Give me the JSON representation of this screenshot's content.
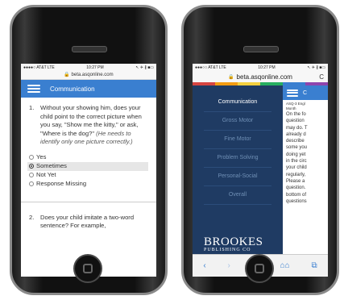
{
  "left_phone": {
    "status": {
      "carrier": "●●●●○ AT&T  LTE",
      "time": "10:27 PM",
      "right": "↖ ✈ ∦ ■▭"
    },
    "url": "🔒 beta.asqonline.com",
    "nav_title": "Communication",
    "question1": {
      "number": "1.",
      "text": "Without your showing him, does your child point to the correct picture when you say, \"Show me the kitty,\" or ask, \"Where is the dog?\"",
      "note": "(He needs to identify only one picture correctly.)"
    },
    "options": [
      "Yes",
      "Sometimes",
      "Not Yet",
      "Response Missing"
    ],
    "selected_option": "Sometimes",
    "question2": {
      "number": "2.",
      "text": "Does your child imitate a two-word sentence? For example,"
    }
  },
  "right_phone": {
    "status": {
      "carrier": "●●●○○ AT&T  LTE",
      "time": "10:27 PM",
      "right": "↖ ✈ ∦ ■▭"
    },
    "url": "beta.asqonline.com",
    "reload": "C",
    "menu_items": [
      "Communication",
      "Gross Motor",
      "Fine Motor",
      "Problem Solving",
      "Personal-Social",
      "Overall"
    ],
    "brand_line1": "BROOKES",
    "brand_line2": "PUBLISHING CO",
    "pane_header_letter": "C",
    "pane_text": [
      "ASQ-3 Engl",
      "Month",
      "On the fo",
      "question",
      "may do. T",
      "already d",
      "describe",
      "some you",
      "doing yet",
      "in the circ",
      "your child",
      "regularly,",
      "Please a",
      "question.",
      "bottom of",
      "questions"
    ],
    "toolbar": [
      "‹",
      "›",
      "⇪",
      "⌂⌂",
      "⧉"
    ]
  },
  "colors": {
    "nav_blue": "#3a7fd0",
    "menu_navy": "#1f3b63",
    "stripe": [
      "#d64541",
      "#f39c12",
      "#f4d03f",
      "#27ae60",
      "#3a7fd0",
      "#8e44ad"
    ]
  }
}
